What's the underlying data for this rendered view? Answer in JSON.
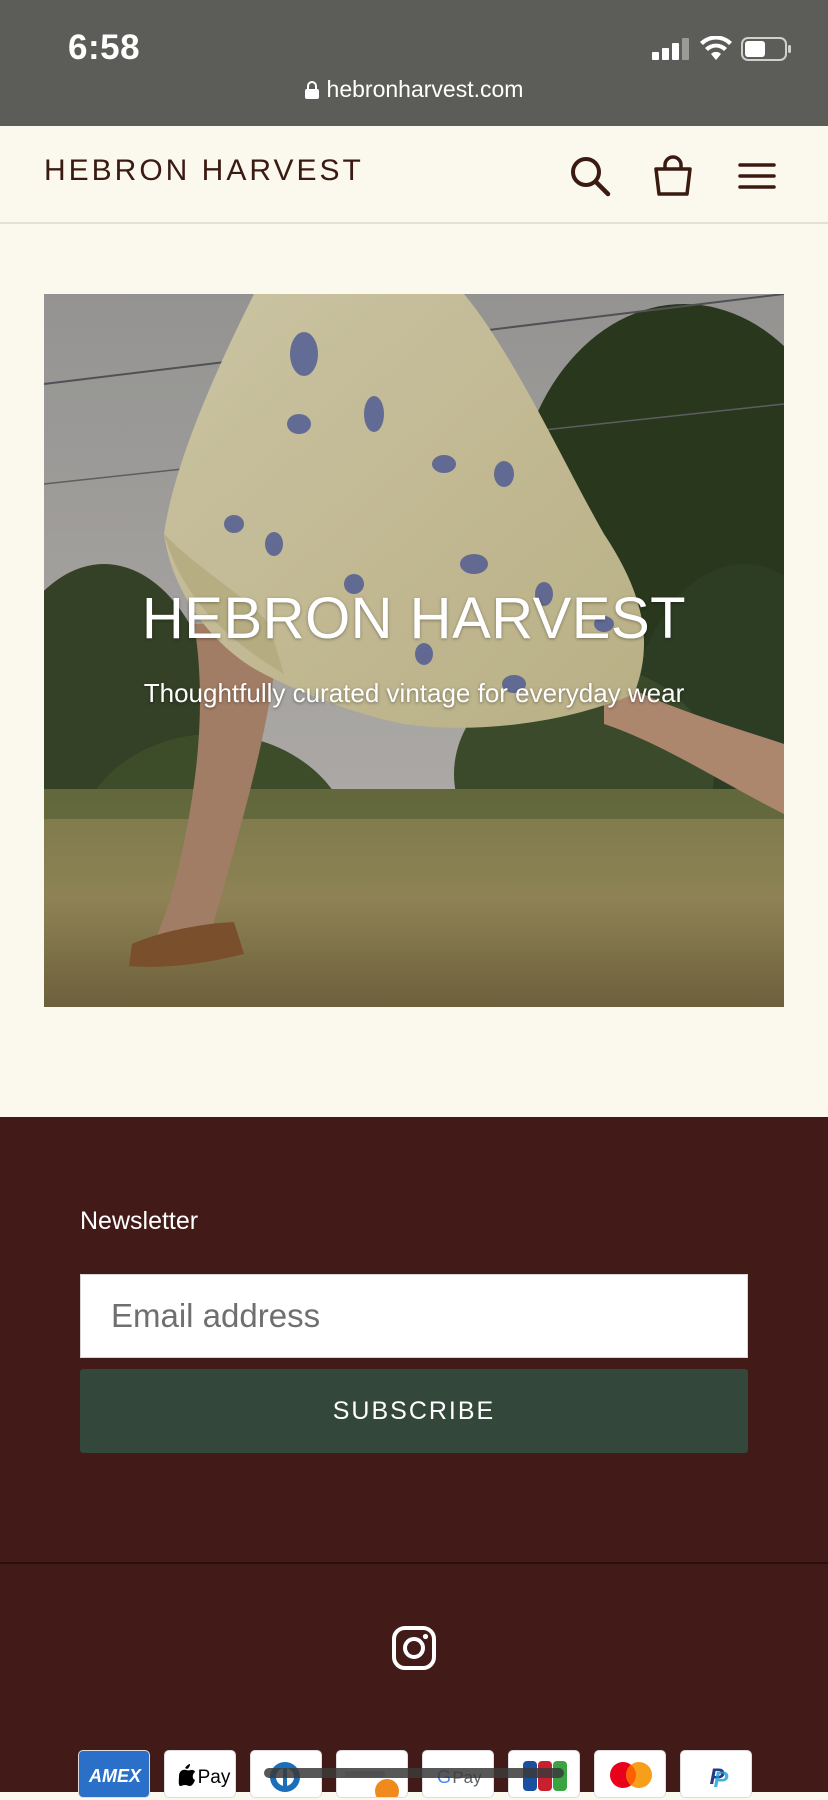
{
  "status_bar": {
    "time": "6:58",
    "url": "hebronharvest.com"
  },
  "header": {
    "logo": "HEBRON HARVEST"
  },
  "hero": {
    "title": "HEBRON HARVEST",
    "subtitle": "Thoughtfully curated vintage for everyday wear"
  },
  "footer": {
    "newsletter_title": "Newsletter",
    "email_placeholder": "Email address",
    "subscribe_label": "SUBSCRIBE",
    "payment_icons": [
      "amex-icon",
      "apple-pay-icon",
      "diners-icon",
      "discover-icon",
      "google-pay-icon",
      "jcb-icon",
      "mastercard-icon",
      "paypal-icon"
    ]
  },
  "colors": {
    "page_bg": "#fbf8ee",
    "brand_text": "#3b1a12",
    "footer_bg": "#421b18",
    "subscribe_bg": "#33483a",
    "status_bar_bg": "#5c5c58"
  }
}
